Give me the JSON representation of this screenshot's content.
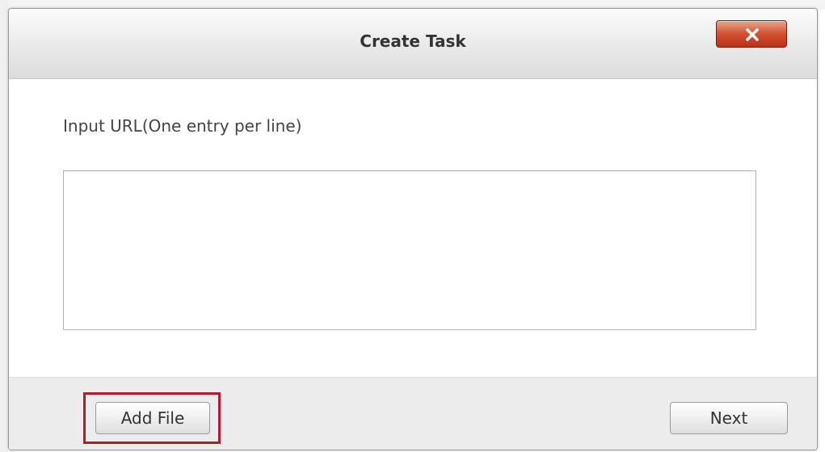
{
  "dialog": {
    "title": "Create Task",
    "close_icon": "close-icon",
    "input_label": "Input URL(One entry per line)",
    "url_input": {
      "value": "",
      "placeholder": ""
    },
    "add_file_label": "Add File",
    "next_label": "Next"
  },
  "colors": {
    "close_button": "#c9462a",
    "highlight_box": "#b01c28",
    "title_text": "#333333"
  }
}
